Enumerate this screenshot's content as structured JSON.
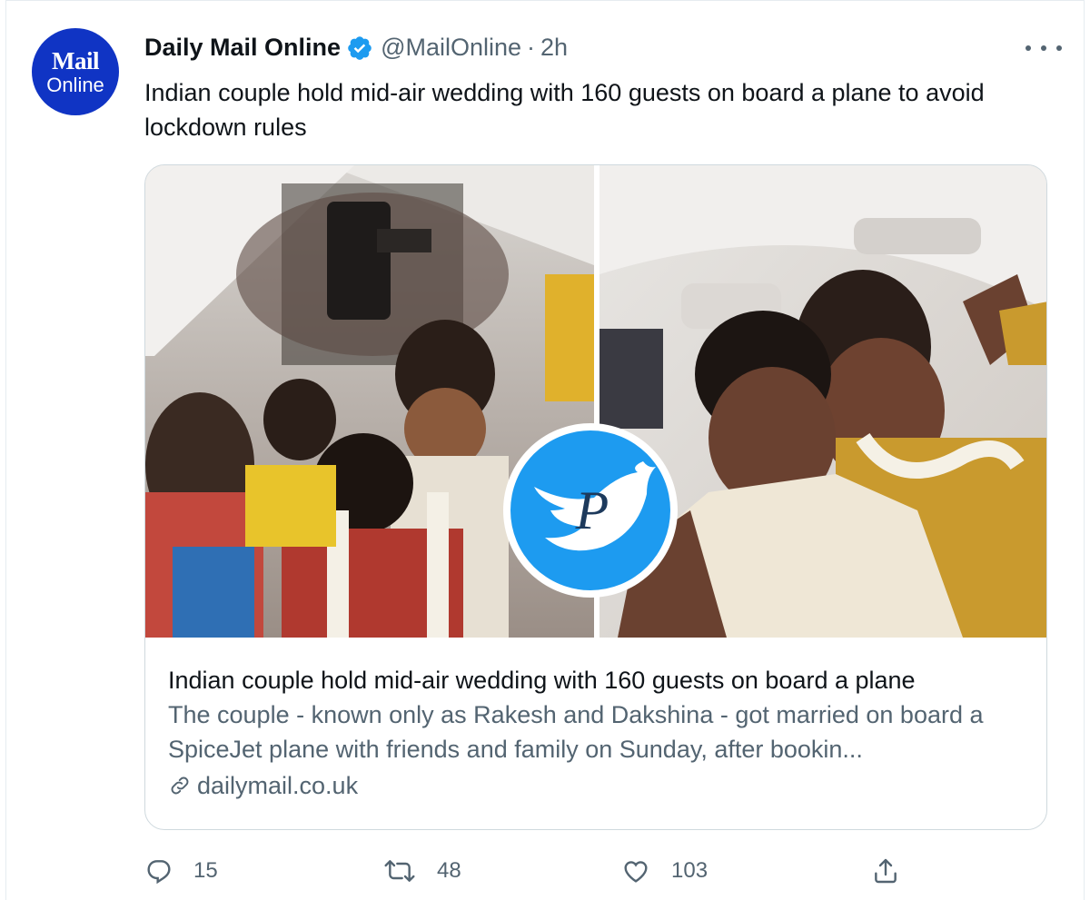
{
  "tweet": {
    "author_name": "Daily Mail Online",
    "handle": "@MailOnline",
    "separator": "·",
    "time": "2h",
    "text": "Indian couple hold mid-air wedding with 160 guests on board a plane to avoid lockdown rules",
    "avatar": {
      "line1": "Mail",
      "line2": "Online",
      "color": "#1034c4"
    }
  },
  "card": {
    "title": "Indian couple hold mid-air wedding with 160 guests on board a plane",
    "description": "The couple - known only as Rakesh and Dakshina - got married on board a SpiceJet plane with friends and family on Sunday, after bookin...",
    "domain": "dailymail.co.uk",
    "watermark_letter": "P"
  },
  "actions": {
    "replies": "15",
    "retweets": "48",
    "likes": "103"
  },
  "colors": {
    "verified": "#1d9bf0",
    "secondary_text": "#536471",
    "border": "#cfd9de"
  },
  "icons": [
    "verified-badge-icon",
    "more-options-icon",
    "link-icon",
    "reply-icon",
    "retweet-icon",
    "like-icon",
    "share-icon"
  ]
}
